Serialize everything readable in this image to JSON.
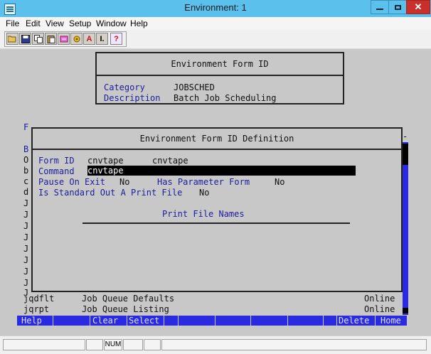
{
  "window": {
    "title": "Environment: 1"
  },
  "menu": [
    "File",
    "Edit",
    "View",
    "Setup",
    "Window",
    "Help"
  ],
  "toolbar": {
    "icons": [
      "open-icon",
      "save-icon",
      "copy-icon",
      "paste-icon",
      "palette-icon",
      "settings-icon",
      "font-icon",
      "text-size-icon",
      "help-icon"
    ],
    "font_label": "A",
    "text_label": "I.",
    "help_label": "?"
  },
  "env_form": {
    "title": "Environment Form ID",
    "category_label": "Category",
    "category_value": "JOBSCHED",
    "description_label": "Description",
    "description_value": "Batch Job Scheduling"
  },
  "background_rows": {
    "left_letters": [
      "F",
      "B",
      "O",
      "b",
      "c",
      "d",
      "J",
      "J",
      "J",
      "J",
      "J",
      "J",
      "J",
      "J",
      "J"
    ],
    "row1_code": "jqdflt",
    "row1_desc": "Job Queue Defaults",
    "row1_status": "Online",
    "row2_code": "jqrpt",
    "row2_desc": "Job Queue Listing",
    "row2_status": "Online"
  },
  "definition": {
    "title": "Environment Form ID Definition",
    "form_id_label": "Form ID",
    "form_id_value1": "cnvtape",
    "form_id_value2": "cnvtape",
    "command_label": "Command",
    "command_value": "cnvtape",
    "pause_label": "Pause On Exit",
    "pause_value": "No",
    "param_label": "Has Parameter Form",
    "param_value": "No",
    "stdout_label": "Is Standard Out A Print File",
    "stdout_value": "No",
    "print_names_title": "Print File Names"
  },
  "function_keys": {
    "help": "Help",
    "clear": "Clear",
    "select": "Select",
    "delete": "Delete",
    "home": "Home"
  },
  "status": {
    "num": "NUM"
  }
}
